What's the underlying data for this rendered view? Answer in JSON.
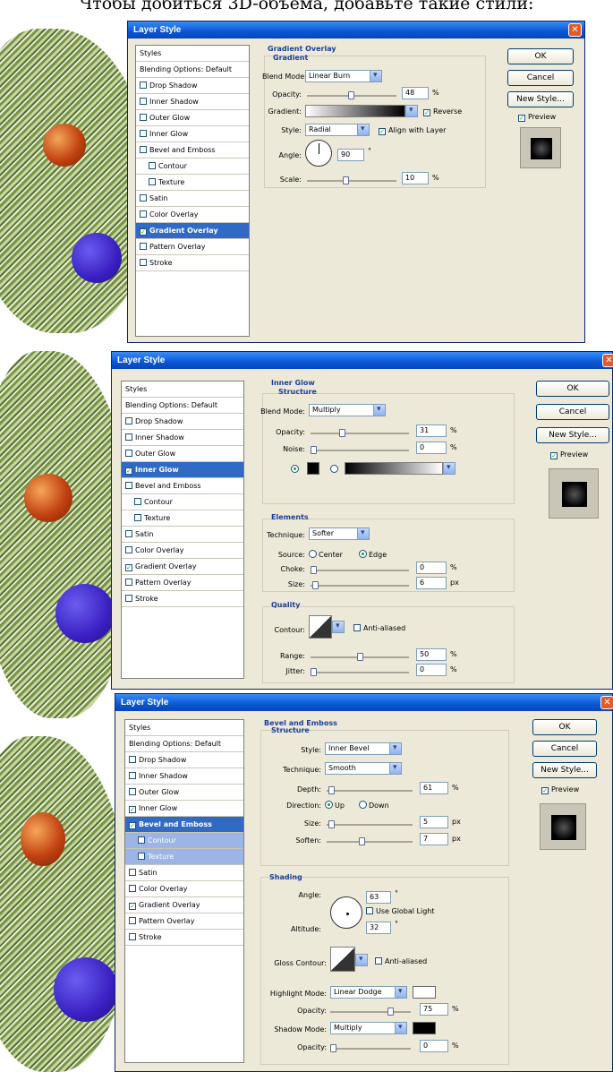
{
  "caption": "Чтобы добиться 3D-объема, добавьте такие стили:",
  "colors": {
    "title_bar": "#0a56d6",
    "dialog_bg": "#ece9d8",
    "selected": "#316ac5",
    "group_title": "#1e3f9a"
  },
  "dialogs": [
    {
      "title": "Layer Style",
      "buttons": {
        "ok": "OK",
        "cancel": "Cancel",
        "new_style": "New Style...",
        "preview": "Preview"
      },
      "styles": [
        "Styles",
        "Blending Options: Default",
        "Drop Shadow",
        "Inner Shadow",
        "Outer Glow",
        "Inner Glow",
        "Bevel and Emboss",
        "Contour",
        "Texture",
        "Satin",
        "Color Overlay",
        "Gradient Overlay",
        "Pattern Overlay",
        "Stroke"
      ],
      "section_title": "Gradient Overlay",
      "group_title": "Gradient",
      "blend_mode_label": "Blend Mode:",
      "blend_mode_value": "Linear Burn",
      "opacity_label": "Opacity:",
      "opacity_value": "48",
      "pct": "%",
      "gradient_label": "Gradient:",
      "reverse_label": "Reverse",
      "style_label": "Style:",
      "style_value": "Radial",
      "align_label": "Align with Layer",
      "angle_label": "Angle:",
      "angle_value": "90",
      "deg": "°",
      "scale_label": "Scale:",
      "scale_value": "10"
    },
    {
      "title": "Layer Style",
      "buttons": {
        "ok": "OK",
        "cancel": "Cancel",
        "new_style": "New Style...",
        "preview": "Preview"
      },
      "section_title": "Inner Glow",
      "structure_title": "Structure",
      "blend_mode_label": "Blend Mode:",
      "blend_mode_value": "Multiply",
      "opacity_label": "Opacity:",
      "opacity_value": "31",
      "pct": "%",
      "noise_label": "Noise:",
      "noise_value": "0",
      "elements_title": "Elements",
      "technique_label": "Technique:",
      "technique_value": "Softer",
      "source_label": "Source:",
      "center_label": "Center",
      "edge_label": "Edge",
      "choke_label": "Choke:",
      "choke_value": "0",
      "size_label": "Size:",
      "size_value": "6",
      "px": "px",
      "quality_title": "Quality",
      "contour_label": "Contour:",
      "antialiased_label": "Anti-aliased",
      "range_label": "Range:",
      "range_value": "50",
      "jitter_label": "Jitter:",
      "jitter_value": "0"
    },
    {
      "title": "Layer Style",
      "buttons": {
        "ok": "OK",
        "cancel": "Cancel",
        "new_style": "New Style...",
        "preview": "Preview"
      },
      "section_title": "Bevel and Emboss",
      "structure_title": "Structure",
      "style_label": "Style:",
      "style_value": "Inner Bevel",
      "technique_label": "Technique:",
      "technique_value": "Smooth",
      "depth_label": "Depth:",
      "depth_value": "61",
      "pct": "%",
      "direction_label": "Direction:",
      "up_label": "Up",
      "down_label": "Down",
      "size_label": "Size:",
      "size_value": "5",
      "px": "px",
      "soften_label": "Soften:",
      "soften_value": "7",
      "shading_title": "Shading",
      "angle_label": "Angle:",
      "angle_value": "63",
      "deg": "°",
      "global_light_label": "Use Global Light",
      "altitude_label": "Altitude:",
      "altitude_value": "32",
      "gloss_label": "Gloss Contour:",
      "antialiased_label": "Anti-aliased",
      "highlight_label": "Highlight Mode:",
      "highlight_value": "Linear Dodge",
      "hl_opacity_label": "Opacity:",
      "hl_opacity_value": "75",
      "shadow_label": "Shadow Mode:",
      "shadow_value": "Multiply",
      "sh_opacity_label": "Opacity:",
      "sh_opacity_value": "0"
    }
  ]
}
